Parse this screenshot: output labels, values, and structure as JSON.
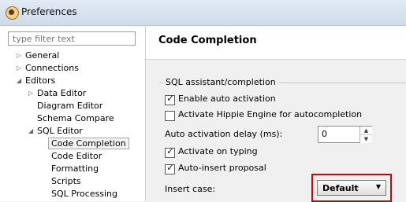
{
  "window": {
    "title": "Preferences",
    "icon": "app-icon"
  },
  "filter": {
    "placeholder": "type filter text"
  },
  "tree": {
    "items": [
      {
        "label": "General",
        "expanded": false
      },
      {
        "label": "Connections",
        "expanded": false
      },
      {
        "label": "Editors",
        "expanded": true
      },
      {
        "label": "Data Editor",
        "expanded": false
      },
      {
        "label": "Diagram Editor"
      },
      {
        "label": "Schema Compare"
      },
      {
        "label": "SQL Editor",
        "expanded": true
      },
      {
        "label": "Code Completion",
        "selected": true
      },
      {
        "label": "Code Editor"
      },
      {
        "label": "Formatting"
      },
      {
        "label": "Scripts"
      },
      {
        "label": "SQL Processing"
      }
    ]
  },
  "page": {
    "title": "Code Completion",
    "group_title": "SQL assistant/completion",
    "options": {
      "enable_auto_activation": "Enable auto activation",
      "activate_hippie": "Activate Hippie Engine for autocompletion",
      "delay_label": "Auto activation delay (ms):",
      "delay_value": "0",
      "activate_on_typing": "Activate on typing",
      "auto_insert": "Auto-insert proposal",
      "insert_case_label": "Insert case:",
      "insert_case_value": "Default"
    },
    "checked": {
      "enable_auto_activation": true,
      "activate_hippie": false,
      "activate_on_typing": true,
      "auto_insert": true
    }
  },
  "colors": {
    "highlight": "#d20000"
  }
}
